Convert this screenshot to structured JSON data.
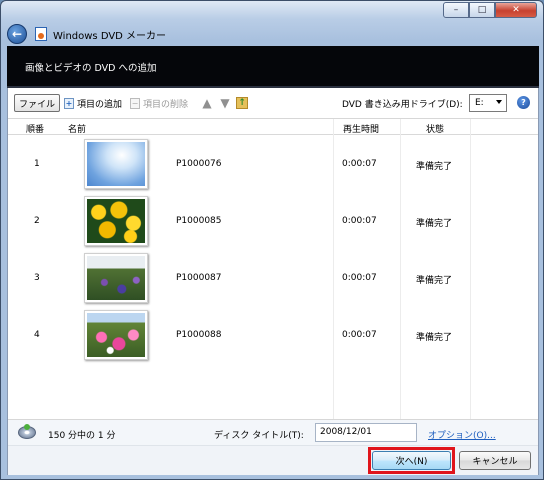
{
  "window": {
    "app_title": "Windows DVD メーカー",
    "banner_title": "画像とビデオの DVD への追加"
  },
  "toolbar": {
    "file_label": "ファイル",
    "add_items_label": "項目の追加",
    "delete_items_label": "項目の削除",
    "drive_label": "DVD 書き込み用ドライブ(D):",
    "drive_value": "E:"
  },
  "list": {
    "columns": [
      "順番",
      "名前",
      "再生時間",
      "状態"
    ],
    "rows": [
      {
        "order": "1",
        "name": "P1000076",
        "duration": "0:00:07",
        "status": "準備完了",
        "thumb": "sky"
      },
      {
        "order": "2",
        "name": "P1000085",
        "duration": "0:00:07",
        "status": "準備完了",
        "thumb": "yellow-flowers"
      },
      {
        "order": "3",
        "name": "P1000087",
        "duration": "0:00:07",
        "status": "準備完了",
        "thumb": "garden"
      },
      {
        "order": "4",
        "name": "P1000088",
        "duration": "0:00:07",
        "status": "準備完了",
        "thumb": "pink-flowers"
      }
    ]
  },
  "status": {
    "capacity_text": "150 分中の 1 分",
    "disc_title_label": "ディスク タイトル(T):",
    "disc_title_value": "2008/12/01",
    "options_link": "オプション(O)..."
  },
  "buttons": {
    "next_label": "次へ(N)",
    "cancel_label": "キャンセル"
  },
  "colors": {
    "highlight": "#e0141b",
    "link": "#1f5fbf",
    "banner_bg": "#05060a"
  },
  "icons": [
    "back-arrow-icon",
    "dvd-maker-icon",
    "add-items-icon",
    "delete-items-icon",
    "move-up-icon",
    "move-down-icon",
    "folder-up-icon",
    "help-icon",
    "disc-icon"
  ]
}
